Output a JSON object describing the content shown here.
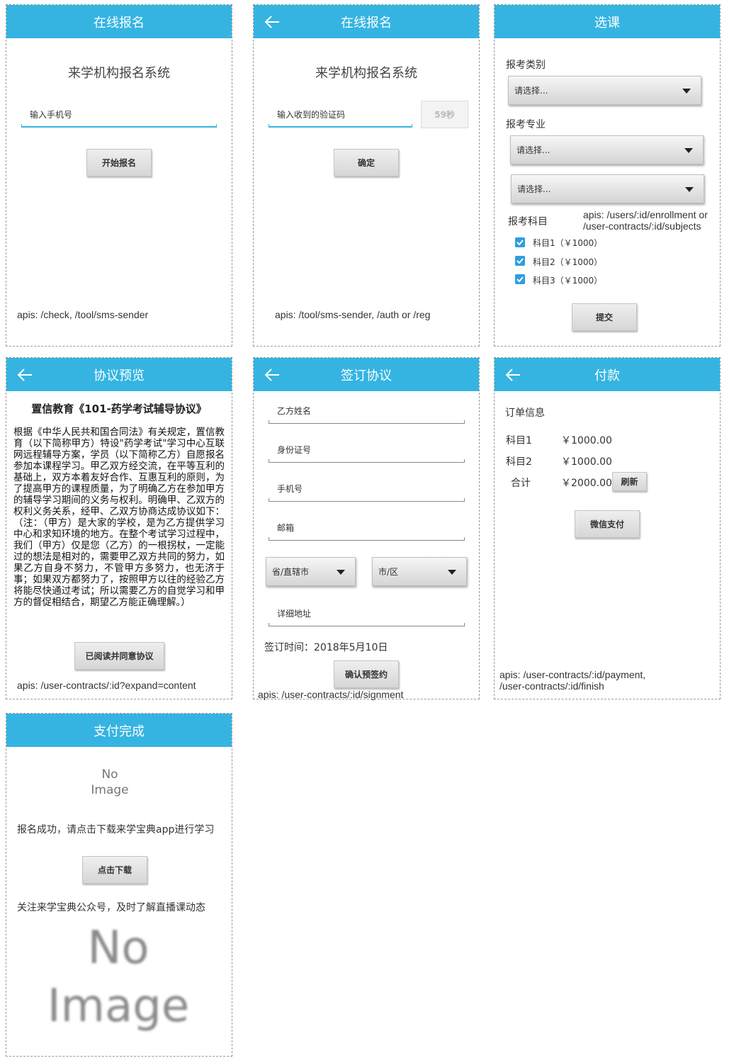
{
  "screens": {
    "s1": {
      "header": "在线报名",
      "system_title": "来学机构报名系统",
      "phone_placeholder": "输入手机号",
      "start_button": "开始报名",
      "apis": "apis: /check, /tool/sms-sender"
    },
    "s2": {
      "header": "在线报名",
      "system_title": "来学机构报名系统",
      "code_placeholder": "输入收到的验证码",
      "countdown_button": "59秒",
      "confirm_button": "确定",
      "apis": "apis: /tool/sms-sender, /auth or /reg"
    },
    "s3": {
      "header": "选课",
      "category_label": "报考类别",
      "select_placeholder": "请选择...",
      "major_label": "报考专业",
      "subjects_label": "报考科目",
      "apis_line1": "apis: /users/:id/enrollment or",
      "apis_line2": "/user-contracts/:id/subjects",
      "subjects": [
        "科目1（￥1000）",
        "科目2（￥1000）",
        "科目3（￥1000）"
      ],
      "submit_button": "提交"
    },
    "s4": {
      "header": "协议预览",
      "agreement_title": "置信教育《101-药学考试辅导协议》",
      "agreement_body": "根据《中华人民共和国合同法》有关规定，置信教育（以下简称甲方）特设\"药学考试\"学习中心互联网远程辅导方案，学员（以下简称乙方）自愿报名参加本课程学习。甲乙双方经交流，在平等互利的基础上，双方本着友好合作、互惠互利的原则，为了提高甲方的课程质量，为了明确乙方在参加甲方的辅导学习期间的义务与权利。明确甲、乙双方的权利义务关系，经甲、乙双方协商达成协议如下：（注：（甲方）是大家的学校，是为乙方提供学习中心和求知环境的地方。在整个考试学习过程中，我们（甲方）仅是您（乙方）的一根拐杖，一定能过的想法是相对的，需要甲乙双方共同的努力，如果乙方自身不努力，不管甲方多努力，也无济于事；如果双方都努力了，按照甲方以往的经验乙方将能尽快通过考试；所以需要乙方的自觉学习和甲方的督促相结合，期望乙方能正确理解。）",
      "agree_button": "已阅读并同意协议",
      "apis": "apis: /user-contracts/:id?expand=content"
    },
    "s5": {
      "header": "签订协议",
      "name_placeholder": "乙方姓名",
      "id_placeholder": "身份证号",
      "phone_placeholder": "手机号",
      "email_placeholder": "邮箱",
      "province_select": "省/直辖市",
      "city_select": "市/区",
      "address_placeholder": "详细地址",
      "sign_time": "签订时间：2018年5月10日",
      "confirm_button": "确认预签约",
      "apis": "apis: /user-contracts/:id/signment"
    },
    "s6": {
      "header": "付款",
      "order_info": "订单信息",
      "rows": [
        {
          "label": "科目1",
          "amount": "￥1000.00"
        },
        {
          "label": "科目2",
          "amount": "￥1000.00"
        }
      ],
      "total_label": "合计",
      "total_amount": "￥2000.00",
      "refresh_button": "刷新",
      "wechat_button": "微信支付",
      "apis_line1": "apis: /user-contracts/:id/payment,",
      "apis_line2": "/user-contracts/:id/finish"
    },
    "s7": {
      "header": "支付完成",
      "no_image_small_1": "No",
      "no_image_small_2": "Image",
      "success_text": "报名成功，请点击下载来学宝典app进行学习",
      "download_button": "点击下载",
      "follow_text": "关注来学宝典公众号，及时了解直播课动态",
      "no_image_large_1": "No",
      "no_image_large_2": "Image"
    }
  },
  "colors": {
    "header": "#35b4e2",
    "checkbox": "#2f9ee0"
  },
  "icons": {
    "back": "back-arrow-icon",
    "caret": "caret-down-icon",
    "check": "checkmark-icon"
  }
}
